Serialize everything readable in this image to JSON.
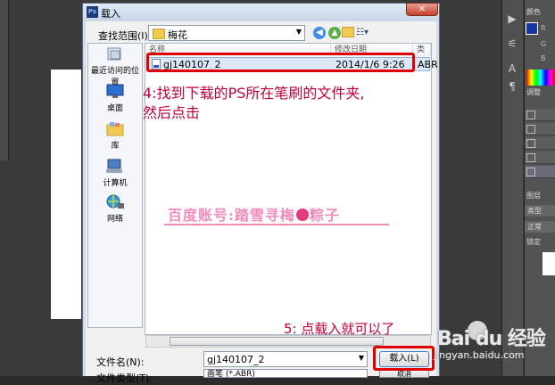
{
  "window": {
    "title": "载入",
    "close_glyph": "✕",
    "app_icon": "Ps"
  },
  "look_in": {
    "label": "查找范围(I):",
    "folder": "梅花"
  },
  "toolbar_icons": [
    "back-icon",
    "up-folder-icon",
    "new-folder-icon",
    "views-menu-icon"
  ],
  "places": [
    {
      "label": "最近访问的位置",
      "icon": "recent-places-icon"
    },
    {
      "label": "桌面",
      "icon": "desktop-icon"
    },
    {
      "label": "库",
      "icon": "libraries-icon"
    },
    {
      "label": "计算机",
      "icon": "computer-icon"
    },
    {
      "label": "网络",
      "icon": "network-icon"
    }
  ],
  "columns": {
    "name": "名称",
    "date": "修改日期",
    "type": "类型"
  },
  "file": {
    "name": "gj140107_2",
    "date": "2014/1/6 9:26",
    "type": "ABR"
  },
  "file_name": {
    "label": "文件名(N):",
    "value": "gj140107_2"
  },
  "file_type": {
    "label": "文件类型(T):",
    "value": "画笔 (*.ABR)"
  },
  "buttons": {
    "load": "载入(L)",
    "cancel": "取消"
  },
  "annotations": {
    "step4_line1": "4:找到下载的PS所在笔刷的文件夹,",
    "step4_line2": "然后点击",
    "step5": "5: 点载入就可以了",
    "wm_before": "百度账号:踏雪寻梅",
    "wm_after": "粽子",
    "highlight_color": "#e00000"
  },
  "photoshop": {
    "tabs": [
      "颜色",
      "R",
      "G",
      "B",
      "调整",
      "图层",
      "类型",
      "正常",
      "锁定"
    ],
    "swatch_color": "#1a33a3"
  },
  "branding": {
    "logo": "Bai  du 经验",
    "url": "jingyan.baidu.com"
  }
}
